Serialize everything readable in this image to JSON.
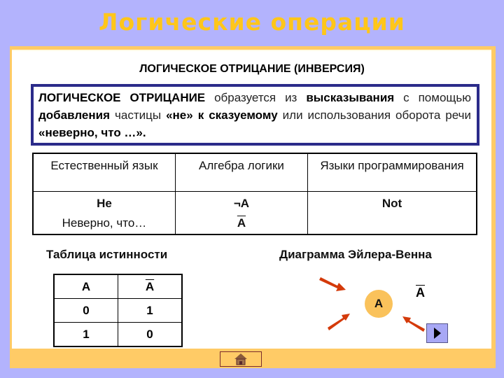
{
  "slide": {
    "title": "Логические операции",
    "subtitle": "ЛОГИЧЕСКОЕ ОТРИЦАНИЕ (ИНВЕРСИЯ)"
  },
  "definition": {
    "term": "ЛОГИЧЕСКОЕ ОТРИЦАНИЕ",
    "t1": " образуется из ",
    "b1": "высказывания",
    "t2": " с помощью ",
    "b2": "добавления",
    "t3": " частицы ",
    "b3": "«не» к сказуемому",
    "t4": " или использования оборота речи ",
    "b4": "«неверно, что …»."
  },
  "comparison_table": {
    "headers": [
      "Естественный язык",
      "Алгебра логики",
      "Языки программирования"
    ],
    "natural_language": [
      "Не",
      "Неверно, что…"
    ],
    "logic_algebra": [
      "¬A",
      "A"
    ],
    "programming": "Not"
  },
  "truth_table": {
    "title": "Таблица истинности",
    "headers": [
      "A",
      "A"
    ],
    "rows": [
      [
        "0",
        "1"
      ],
      [
        "1",
        "0"
      ]
    ]
  },
  "venn": {
    "title": "Диаграмма Эйлера-Венна",
    "set_label": "A",
    "complement_label": "A"
  },
  "colors": {
    "background": "#b3b3fd",
    "title": "#ffc61a",
    "frame": "#ffcb66",
    "definition_border": "#2b2b8a",
    "circle": "#fac25b",
    "arrow": "#d43a0a"
  },
  "nav": {
    "next_icon": "play-triangle-icon",
    "home_icon": "house-icon"
  }
}
